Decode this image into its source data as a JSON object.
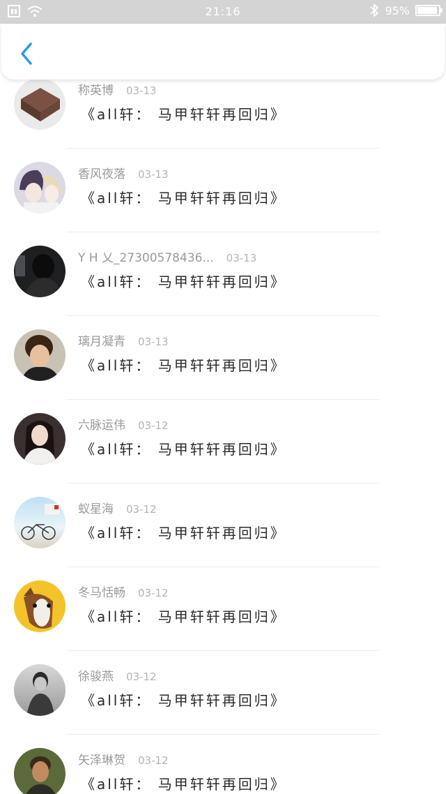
{
  "status_bar": {
    "time": "21:16",
    "battery_text": "95%",
    "icons": [
      "sim-icon",
      "wifi-icon",
      "bluetooth-icon",
      "battery-icon"
    ]
  },
  "header": {
    "back_icon": "chevron-left-icon",
    "accent": "#2a9af0"
  },
  "items": [
    {
      "name": "称英博",
      "date": "03-13",
      "message": "《all轩： 马甲轩轩再回归》",
      "avatar": "brown-block-avatar"
    },
    {
      "name": "香风夜落",
      "date": "03-13",
      "message": "《all轩： 马甲轩轩再回归》",
      "avatar": "anime-boys-avatar"
    },
    {
      "name": "Y H 乂_27300578436...",
      "date": "03-13",
      "message": "《all轩： 马甲轩轩再回归》",
      "avatar": "dark-photo-avatar"
    },
    {
      "name": "璃月凝青",
      "date": "03-13",
      "message": "《all轩： 马甲轩轩再回归》",
      "avatar": "boy-photo-avatar"
    },
    {
      "name": "六脉运伟",
      "date": "03-12",
      "message": "《all轩： 马甲轩轩再回归》",
      "avatar": "girl-photo-avatar"
    },
    {
      "name": "蚁星海",
      "date": "03-12",
      "message": "《all轩： 马甲轩轩再回归》",
      "avatar": "bicycle-avatar"
    },
    {
      "name": "冬马恬畅",
      "date": "03-12",
      "message": "《all轩： 马甲轩轩再回归》",
      "avatar": "cartoon-horse-avatar"
    },
    {
      "name": "徐骏燕",
      "date": "03-12",
      "message": "《all轩： 马甲轩轩再回归》",
      "avatar": "bw-photo-avatar"
    },
    {
      "name": "矢泽琳贺",
      "date": "03-12",
      "message": "《all轩： 马甲轩轩再回归》",
      "avatar": "man-photo-avatar"
    }
  ]
}
